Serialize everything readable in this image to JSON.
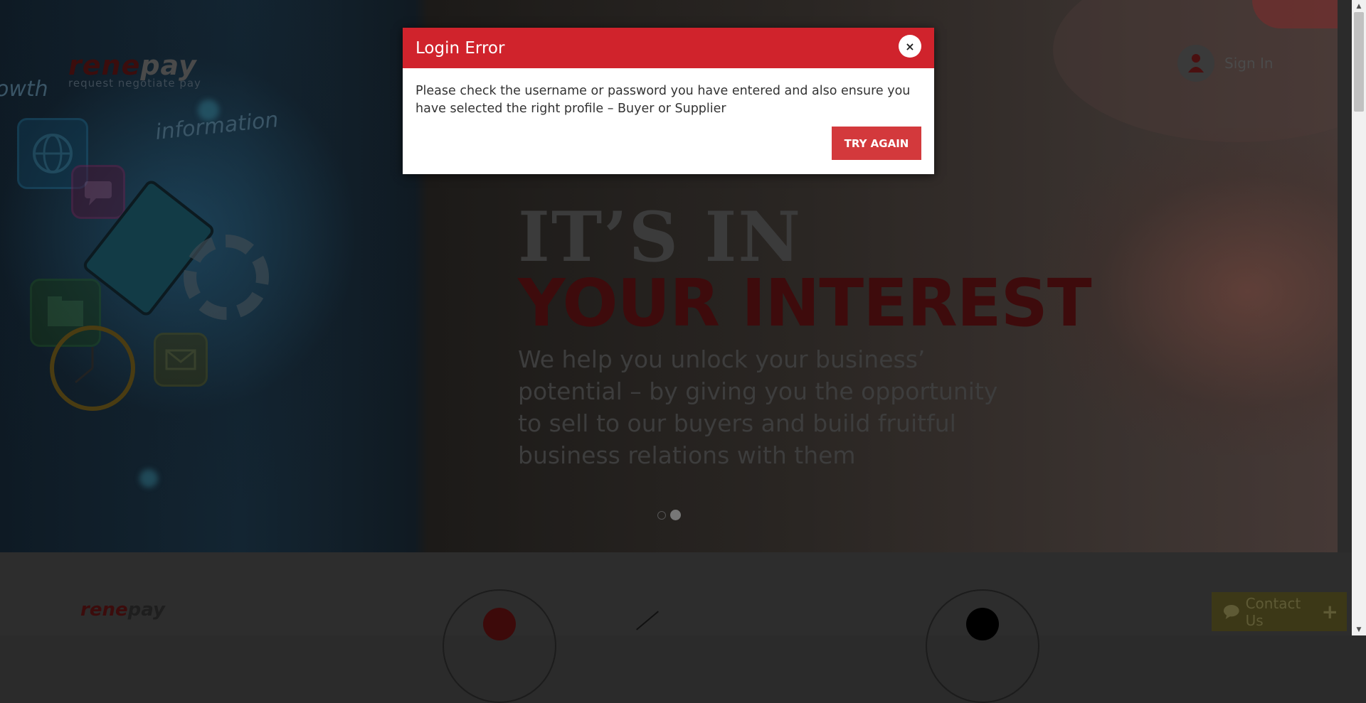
{
  "brand": {
    "logo_red": "rene",
    "logo_dark": "pay",
    "tagline": "request negotiate pay"
  },
  "hero_sketch": {
    "word_left": "owth",
    "word_info": "information"
  },
  "header": {
    "sign_in_label": "Sign In"
  },
  "hero": {
    "headline_line1": "IT’S IN",
    "headline_line2": "YOUR INTEREST",
    "description": "We help you unlock your business’ potential – by giving you the opportunity to sell to our buyers and build fruitful business relations with them",
    "carousel": {
      "count": 2,
      "active_index": 1
    }
  },
  "footer_section": {
    "logo_red": "rene",
    "logo_dark": "pay"
  },
  "contact_widget": {
    "label": "Contact Us",
    "plus": "+"
  },
  "modal": {
    "title": "Login Error",
    "close_glyph": "×",
    "message": "Please check the username or password you have entered and also ensure you have selected the right profile – Buyer or Supplier",
    "button_label": "TRY AGAIN"
  },
  "scrollbar": {
    "up_glyph": "▲",
    "down_glyph": "▼"
  },
  "colors": {
    "modal_header": "#d0232c",
    "button": "#d3393c",
    "accent_red": "#d0232c"
  },
  "icons": [
    "user-icon",
    "chat-bubble-icon",
    "close-icon",
    "globe-icon",
    "chat-icon",
    "folder-icon",
    "mail-icon",
    "clock-icon",
    "gear-icon"
  ]
}
